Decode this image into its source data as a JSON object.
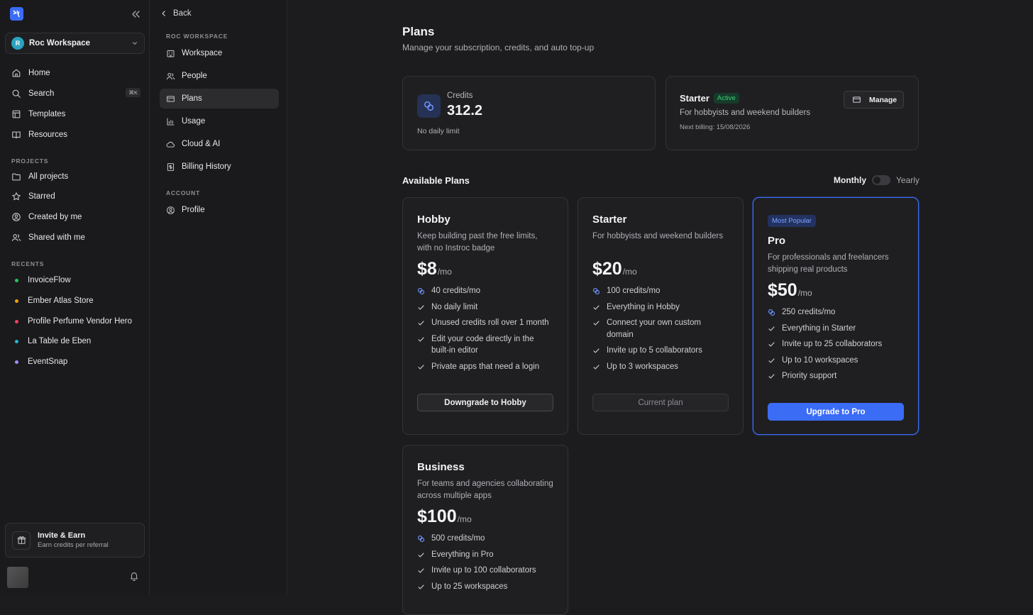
{
  "sidebar": {
    "workspace": {
      "avatar": "R",
      "name": "Roc Workspace"
    },
    "nav": [
      {
        "label": "Home",
        "icon": "home-icon"
      },
      {
        "label": "Search",
        "icon": "search-icon",
        "shortcut": "⌘K"
      },
      {
        "label": "Templates",
        "icon": "template-icon"
      },
      {
        "label": "Resources",
        "icon": "book-icon"
      }
    ],
    "projects_heading": "PROJECTS",
    "projects": [
      {
        "label": "All projects",
        "icon": "folder-icon"
      },
      {
        "label": "Starred",
        "icon": "star-icon"
      },
      {
        "label": "Created by me",
        "icon": "user-circle-icon"
      },
      {
        "label": "Shared with me",
        "icon": "users-icon"
      }
    ],
    "recents_heading": "RECENTS",
    "recents": [
      {
        "label": "InvoiceFlow",
        "color": "#22c55e"
      },
      {
        "label": "Ember Atlas Store",
        "color": "#f59e0b"
      },
      {
        "label": "Profile Perfume Vendor Hero",
        "color": "#f43f5e"
      },
      {
        "label": "La Table de Eben",
        "color": "#22b8cf"
      },
      {
        "label": "EventSnap",
        "color": "#a78bfa"
      }
    ],
    "invite": {
      "title": "Invite & Earn",
      "subtitle": "Earn credits per referral"
    }
  },
  "settings_nav": {
    "back_label": "Back",
    "workspace_heading": "ROC WORKSPACE",
    "items": [
      {
        "label": "Workspace",
        "icon": "building-icon"
      },
      {
        "label": "People",
        "icon": "people-icon"
      },
      {
        "label": "Plans",
        "icon": "card-icon",
        "active": true
      },
      {
        "label": "Usage",
        "icon": "bar-chart-icon"
      },
      {
        "label": "Cloud & AI",
        "icon": "cloud-icon"
      },
      {
        "label": "Billing History",
        "icon": "receipt-icon"
      }
    ],
    "account_heading": "ACCOUNT",
    "account_items": [
      {
        "label": "Profile",
        "icon": "profile-icon"
      }
    ]
  },
  "page": {
    "title": "Plans",
    "subtitle": "Manage your subscription, credits, and auto top-up"
  },
  "credits_card": {
    "label": "Credits",
    "value": "312.2",
    "note": "No daily limit"
  },
  "current_plan_card": {
    "name": "Starter",
    "badge": "Active",
    "description": "For hobbyists and weekend builders",
    "next_billing": "Next billing: 15/08/2026",
    "manage_label": "Manage"
  },
  "available": {
    "heading": "Available Plans",
    "toggle_left": "Monthly",
    "toggle_right": "Yearly",
    "yearly_selected": false
  },
  "plans": [
    {
      "name": "Hobby",
      "description": "Keep building past the free limits, with no Instroc badge",
      "price": "$8",
      "period": "/mo",
      "credits": "40 credits/mo",
      "features": [
        "No daily limit",
        "Unused credits roll over 1 month",
        "Edit your code directly in the built-in editor",
        "Private apps that need a login"
      ],
      "button": "Downgrade to Hobby"
    },
    {
      "name": "Starter",
      "description": "For hobbyists and weekend builders",
      "price": "$20",
      "period": "/mo",
      "credits": "100 credits/mo",
      "features": [
        "Everything in Hobby",
        "Connect your own custom domain",
        "Invite up to 5 collaborators",
        "Up to 3 workspaces"
      ],
      "button": "Current plan"
    },
    {
      "name": "Pro",
      "badge": "Most Popular",
      "description": "For professionals and freelancers shipping real products",
      "price": "$50",
      "period": "/mo",
      "credits": "250 credits/mo",
      "features": [
        "Everything in Starter",
        "Invite up to 25 collaborators",
        "Up to 10 workspaces",
        "Priority support"
      ],
      "button": "Upgrade to Pro"
    },
    {
      "name": "Business",
      "description": "For teams and agencies collaborating across multiple apps",
      "price": "$100",
      "period": "/mo",
      "credits": "500 credits/mo",
      "features": [
        "Everything in Pro",
        "Invite up to 100 collaborators",
        "Up to 25 workspaces"
      ]
    }
  ]
}
